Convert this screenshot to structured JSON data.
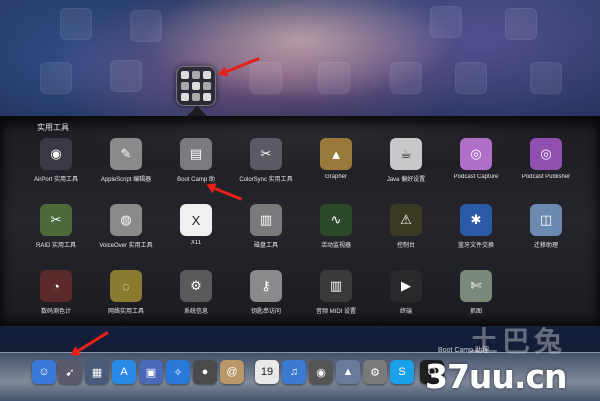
{
  "folder": {
    "title": "实用工具",
    "items": [
      {
        "label": "AirPort 实用工具",
        "icon": "airport-utility-icon",
        "color": "#3a3a44"
      },
      {
        "label": "AppleScript 编辑器",
        "icon": "applescript-editor-icon",
        "color": "#8a8a8a"
      },
      {
        "label": "Boot Camp 助",
        "icon": "boot-camp-assistant-icon",
        "color": "#7a7a80"
      },
      {
        "label": "ColorSync 实用工具",
        "icon": "colorsync-utility-icon",
        "color": "#5a5a62"
      },
      {
        "label": "Grapher",
        "icon": "grapher-icon",
        "color": "#9a7a3a"
      },
      {
        "label": "Java 偏好设置",
        "icon": "java-preferences-icon",
        "color": "#c8c8c8"
      },
      {
        "label": "Podcast Capture",
        "icon": "podcast-capture-icon",
        "color": "#b070c8"
      },
      {
        "label": "Podcast Publisher",
        "icon": "podcast-publisher-icon",
        "color": "#9050b0"
      },
      {
        "label": "RAID 实用工具",
        "icon": "raid-utility-icon",
        "color": "#4a6a3a"
      },
      {
        "label": "VoiceOver 实用工具",
        "icon": "voiceover-utility-icon",
        "color": "#8a8a8a"
      },
      {
        "label": "X11",
        "icon": "x11-icon",
        "color": "#f0f0f0"
      },
      {
        "label": "磁盘工具",
        "icon": "disk-utility-icon",
        "color": "#7a7a7a"
      },
      {
        "label": "活动监视器",
        "icon": "activity-monitor-icon",
        "color": "#2a4a2a"
      },
      {
        "label": "控制台",
        "icon": "console-icon",
        "color": "#3a3a20"
      },
      {
        "label": "蓝牙文件交换",
        "icon": "bluetooth-file-exchange-icon",
        "color": "#2a5aa8"
      },
      {
        "label": "迁移助理",
        "icon": "migration-assistant-icon",
        "color": "#6a8ab0"
      },
      {
        "label": "数码测色计",
        "icon": "digital-color-meter-icon",
        "color": "#5a2a2a"
      },
      {
        "label": "网络实用工具",
        "icon": "network-utility-icon",
        "color": "#8a7a30"
      },
      {
        "label": "系统信息",
        "icon": "system-information-icon",
        "color": "#5a5a5a"
      },
      {
        "label": "钥匙串访问",
        "icon": "keychain-access-icon",
        "color": "#8a8a8a"
      },
      {
        "label": "音频 MIDI 设置",
        "icon": "audio-midi-setup-icon",
        "color": "#3a3a3a"
      },
      {
        "label": "终端",
        "icon": "terminal-icon",
        "color": "#2a2a2a"
      },
      {
        "label": "抓图",
        "icon": "grab-icon",
        "color": "#7a8a7a"
      }
    ]
  },
  "dock": {
    "tooltip": "Boot Camp 助理",
    "icons": [
      {
        "name": "finder-icon",
        "color": "#3a7ad8",
        "glyph": "☺"
      },
      {
        "name": "launchpad-icon",
        "color": "#5a5a6a",
        "glyph": "➹"
      },
      {
        "name": "mission-control-icon",
        "color": "#4a5a7a",
        "glyph": "▦"
      },
      {
        "name": "app-store-icon",
        "color": "#2a8ae8",
        "glyph": "A"
      },
      {
        "name": "preview-icon",
        "color": "#4a6ab8",
        "glyph": "▣"
      },
      {
        "name": "safari-icon",
        "color": "#2a78d8",
        "glyph": "✧"
      },
      {
        "name": "facetime-icon",
        "color": "#4a4a4a",
        "glyph": "●"
      },
      {
        "name": "address-book-icon",
        "color": "#b89868",
        "glyph": "@"
      },
      {
        "name": "ical-icon",
        "color": "#e8e8e8",
        "glyph": "19"
      },
      {
        "name": "itunes-icon",
        "color": "#3a7ad0",
        "glyph": "♫"
      },
      {
        "name": "photo-booth-icon",
        "color": "#555555",
        "glyph": "◉"
      },
      {
        "name": "iphoto-icon",
        "color": "#6a7a9a",
        "glyph": "▲"
      },
      {
        "name": "system-preferences-icon",
        "color": "#7a7a7a",
        "glyph": "⚙"
      },
      {
        "name": "skype-icon",
        "color": "#1aa0e8",
        "glyph": "S"
      },
      {
        "name": "qq-icon",
        "color": "#202020",
        "glyph": "Q"
      }
    ]
  },
  "watermark": {
    "text": "37uu.cn",
    "cn": "土巴兔"
  }
}
